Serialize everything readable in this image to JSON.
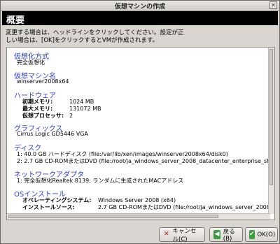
{
  "window": {
    "title": "仮想マシンの作成",
    "close_glyph": "✕"
  },
  "header": {
    "title": "概要"
  },
  "info": {
    "line1": "変更する場合は、ヘッドラインをクリックしてください。設定が正",
    "line2": "しい場合は、[OK]をクリックするとVMが作成されます。"
  },
  "summary": {
    "virtualization": {
      "heading": "仮想化方式",
      "value": "完全仮想化"
    },
    "vm_name": {
      "heading": "仮想マシン名",
      "value": "winserver2008x64"
    },
    "hardware": {
      "heading": "ハードウェア",
      "rows": [
        {
          "label": "初期メモリ:",
          "value": "1024 MB"
        },
        {
          "label": "最大メモリ:",
          "value": "131072 MB"
        },
        {
          "label": "仮想プロセッサ:",
          "value": "2"
        }
      ]
    },
    "graphics": {
      "heading": "グラフィックス",
      "value": "Cirrus Logic GD5446 VGA"
    },
    "disks": {
      "heading": "ディスク",
      "items": [
        "1: 40.0 GB ハードディスク (file:/var/lib/xen/images/winserver2008x64/disk0)",
        "2: 2.7 GB CD-ROMまたはDVD (file:/root/ja_windows_server_2008_datacenter_enterprise_standard_x6"
      ]
    },
    "network": {
      "heading": "ネットワークアダプタ",
      "items": [
        "1: 完全仮想化Realtek 8139; ランダムに生成されたMACアドレス"
      ]
    },
    "os": {
      "heading": "OSインストール",
      "rows": [
        {
          "label": "オペレーティングシステム:",
          "value": "Windows Server 2008 (x64)"
        },
        {
          "label": "インストールソース:",
          "value": "2.7 GB CD-ROMまたはDVD (file:/root/ja_windows_server_2008_datacente"
        }
      ]
    }
  },
  "buttons": {
    "cancel": "キャンセル(C)",
    "back": "戻る(B)",
    "ok": "OK(O)"
  }
}
